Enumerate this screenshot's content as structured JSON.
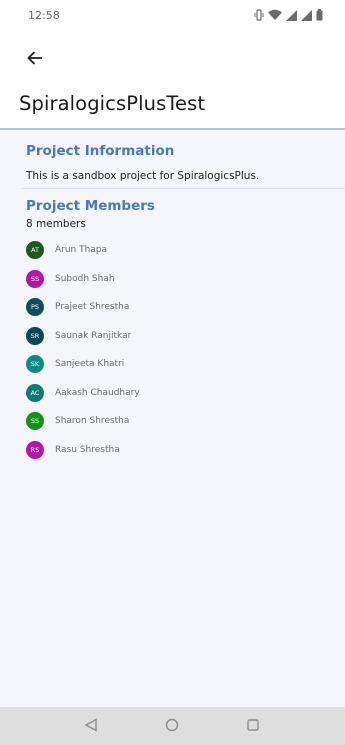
{
  "status_bar": {
    "time": "12:58",
    "icons": [
      "vibrate-icon",
      "wifi-icon",
      "signal-icon",
      "signal-icon",
      "battery-icon"
    ]
  },
  "app_bar": {
    "back_icon": "arrow-left-icon",
    "title": "SpiralogicsPlusTest"
  },
  "project_info": {
    "heading": "Project Information",
    "description": "This is a sandbox project for SpiralogicsPlus."
  },
  "project_members": {
    "heading": "Project Members",
    "count_label": "8 members",
    "members": [
      {
        "initials": "AT",
        "name": "Arun Thapa",
        "color": "#1e5a1e"
      },
      {
        "initials": "SS",
        "name": "Subodh Shah",
        "color": "#b516a8"
      },
      {
        "initials": "PS",
        "name": "Prajeet Shrestha",
        "color": "#0f4d5a"
      },
      {
        "initials": "SR",
        "name": "Saunak Ranjitkar",
        "color": "#0d4654"
      },
      {
        "initials": "SK",
        "name": "Sanjeeta Khatri",
        "color": "#0f8a80"
      },
      {
        "initials": "AC",
        "name": "Aakash Chaudhary",
        "color": "#0f7a70"
      },
      {
        "initials": "SS",
        "name": "Sharon Shrestha",
        "color": "#129412"
      },
      {
        "initials": "RS",
        "name": "Rasu Shrestha",
        "color": "#b516a8"
      }
    ]
  },
  "nav_bar": {
    "buttons": [
      "back-triangle-icon",
      "home-circle-icon",
      "recents-square-icon"
    ]
  }
}
